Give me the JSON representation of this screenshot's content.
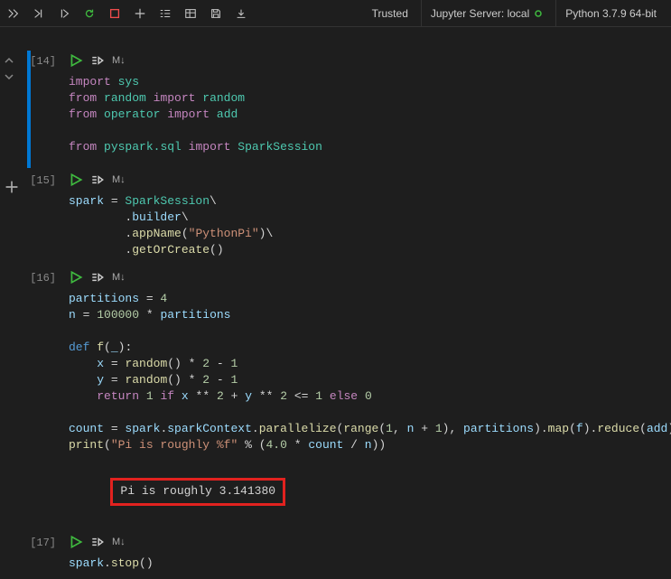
{
  "toolbar": {
    "status_trusted": "Trusted",
    "server_label": "Jupyter Server: local",
    "kernel_label": "Python 3.7.9 64-bit",
    "markdown_label": "M↓"
  },
  "cells": [
    {
      "execution_label": "[14]",
      "code_html": "<span class='kw-import'>import</span> <span class='kw-module'>sys</span>\n<span class='kw-import'>from</span> <span class='kw-module'>random</span> <span class='kw-import'>import</span> <span class='kw-module'>random</span>\n<span class='kw-import'>from</span> <span class='kw-module'>operator</span> <span class='kw-import'>import</span> <span class='kw-module'>add</span>\n\n<span class='kw-import'>from</span> <span class='kw-module'>pyspark.sql</span> <span class='kw-import'>import</span> <span class='kw-module'>SparkSession</span>"
    },
    {
      "execution_label": "[15]",
      "code_html": "<span class='var'>spark</span> = <span class='kw-module'>SparkSession</span>\\\n        .<span class='var'>builder</span>\\\n        .<span class='fn-call'>appName</span>(<span class='str'>\"PythonPi\"</span>)\\\n        .<span class='fn-call'>getOrCreate</span>()"
    },
    {
      "execution_label": "[16]",
      "code_html": "<span class='var'>partitions</span> = <span class='num'>4</span>\n<span class='var'>n</span> = <span class='num'>100000</span> <span class='op'>*</span> <span class='var'>partitions</span>\n\n<span class='kw-def'>def</span> <span class='fn-name'>f</span>(<span class='var'>_</span>):\n    <span class='var'>x</span> = <span class='fn-call'>random</span>() <span class='op'>*</span> <span class='num'>2</span> <span class='op'>-</span> <span class='num'>1</span>\n    <span class='var'>y</span> = <span class='fn-call'>random</span>() <span class='op'>*</span> <span class='num'>2</span> <span class='op'>-</span> <span class='num'>1</span>\n    <span class='kw-control'>return</span> <span class='num'>1</span> <span class='kw-control'>if</span> <span class='var'>x</span> <span class='op'>**</span> <span class='num'>2</span> <span class='op'>+</span> <span class='var'>y</span> <span class='op'>**</span> <span class='num'>2</span> <span class='op'>&lt;=</span> <span class='num'>1</span> <span class='kw-control'>else</span> <span class='num'>0</span>\n\n<span class='var'>count</span> = <span class='var'>spark</span>.<span class='var'>sparkContext</span>.<span class='fn-call'>parallelize</span>(<span class='fn-call'>range</span>(<span class='num'>1</span>, <span class='var'>n</span> <span class='op'>+</span> <span class='num'>1</span>), <span class='var'>partitions</span>).<span class='fn-call'>map</span>(<span class='var'>f</span>).<span class='fn-call'>reduce</span>(<span class='var'>add</span>)\n<span class='fn-call'>print</span>(<span class='str'>\"Pi is roughly %f\"</span> <span class='op'>%</span> (<span class='num'>4.0</span> <span class='op'>*</span> <span class='var'>count</span> <span class='op'>/</span> <span class='var'>n</span>))",
      "output": "Pi is roughly 3.141380"
    },
    {
      "execution_label": "[17]",
      "code_html": "<span class='var'>spark</span>.<span class='fn-call'>stop</span>()"
    }
  ]
}
